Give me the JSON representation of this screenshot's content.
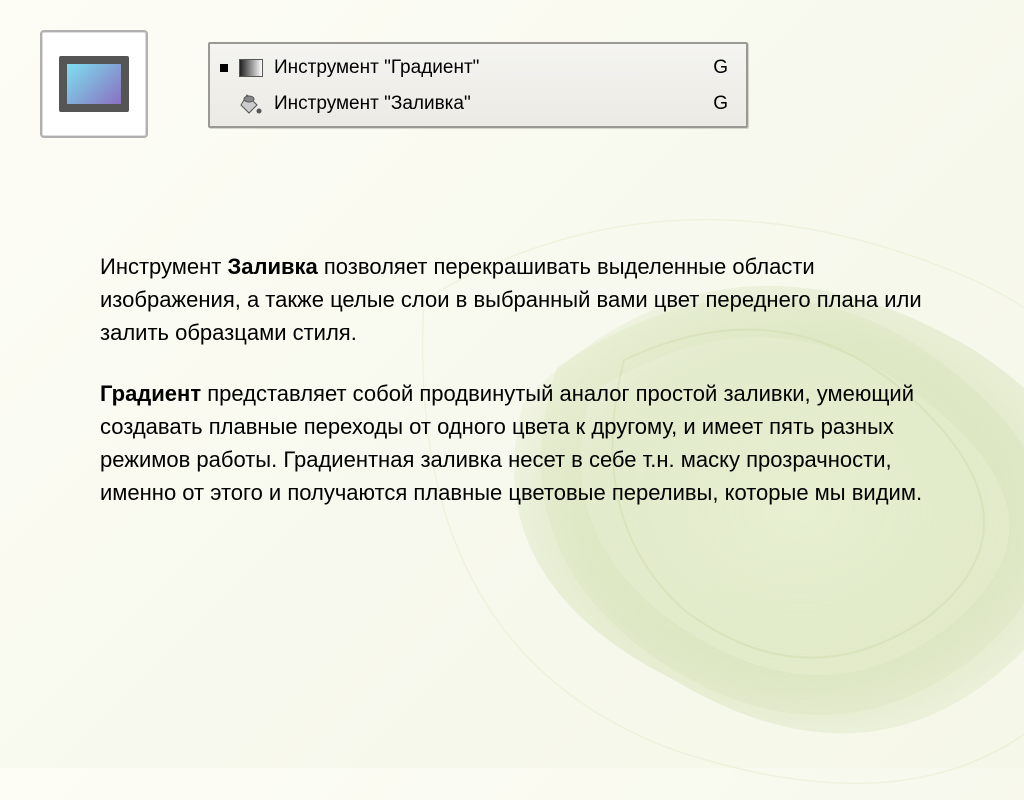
{
  "toolbar": {
    "gradient": {
      "label": "Инструмент \"Градиент\"",
      "shortcut": "G"
    },
    "fill": {
      "label": "Инструмент \"Заливка\"",
      "shortcut": "G"
    }
  },
  "text": {
    "p1_intro": "Инструмент ",
    "p1_bold": "Заливка",
    "p1_rest": " позволяет перекрашивать выделенные области изображения, а также целые слои в выбранный вами цвет переднего плана или залить образцами стиля.",
    "p2_bold": "Градиент",
    "p2_rest": " представляет собой продвинутый аналог простой заливки, умеющий создавать плавные переходы от одного цвета к другому, и имеет пять разных режимов работы. Градиентная заливка несет в себе т.н. маску прозрачности, именно от этого и получаются плавные цветовые переливы, которые мы видим."
  }
}
